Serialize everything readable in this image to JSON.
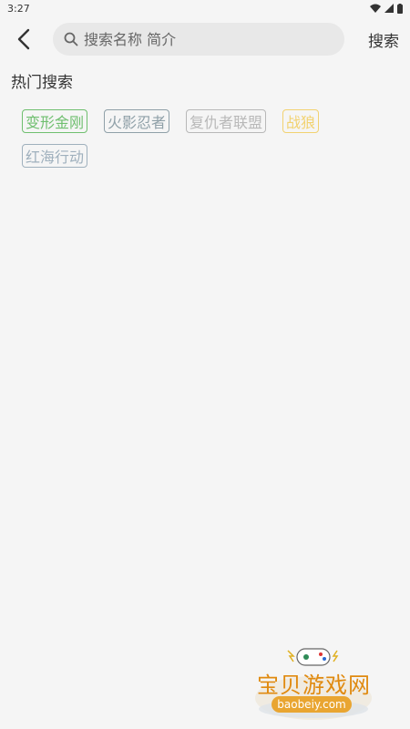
{
  "status_bar": {
    "time": "3:27"
  },
  "header": {
    "search_placeholder": "搜索名称 简介",
    "search_button": "搜索"
  },
  "hot_search": {
    "title": "热门搜索",
    "tags": [
      {
        "label": "变形金刚",
        "color": "#6fbf6f"
      },
      {
        "label": "火影忍者",
        "color": "#8fa0a8"
      },
      {
        "label": "复仇者联盟",
        "color": "#b8b8b8"
      },
      {
        "label": "战狼",
        "color": "#f2d270"
      },
      {
        "label": "红海行动",
        "color": "#9fb0bd"
      }
    ]
  },
  "watermark": {
    "text": "宝贝游戏网",
    "url": "baobeiy.com"
  }
}
